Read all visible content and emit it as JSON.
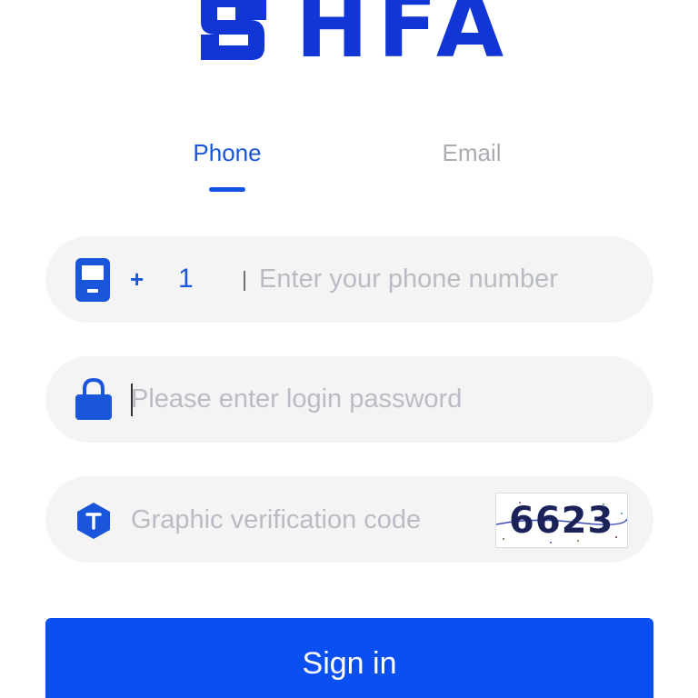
{
  "logo": {
    "text": "HFA",
    "color": "#1236d6"
  },
  "tabs": [
    {
      "label": "Phone",
      "active": true
    },
    {
      "label": "Email",
      "active": false
    }
  ],
  "phone": {
    "icon": "mobile-phone-icon",
    "country_plus": "+",
    "country_code": "1",
    "placeholder": "Enter your phone number"
  },
  "password": {
    "icon": "lock-icon",
    "placeholder": "Please enter login password"
  },
  "captcha": {
    "icon": "hexagon-t-icon",
    "placeholder": "Graphic verification code",
    "code": "6623"
  },
  "signin": {
    "label": "Sign in"
  },
  "colors": {
    "accent": "#1a56db",
    "button": "#0a4ff2",
    "field_bg": "#f4f4f5",
    "placeholder": "#b9bcc2"
  }
}
